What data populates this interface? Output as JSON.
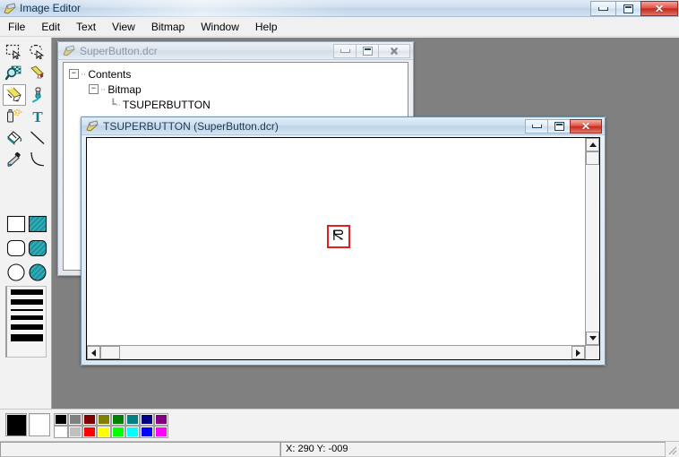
{
  "app": {
    "title": "Image Editor",
    "icon": "image-editor-icon",
    "window_controls": [
      {
        "name": "minimize",
        "glyph": "minimize-icon"
      },
      {
        "name": "maximize",
        "glyph": "maximize-icon"
      },
      {
        "name": "close",
        "glyph": "✕"
      }
    ]
  },
  "menu": {
    "items": [
      {
        "label": "File"
      },
      {
        "label": "Edit"
      },
      {
        "label": "Text"
      },
      {
        "label": "View"
      },
      {
        "label": "Bitmap"
      },
      {
        "label": "Window"
      },
      {
        "label": "Help"
      }
    ]
  },
  "toolbox": {
    "tools": [
      {
        "name": "rectangular-select-tool",
        "icon": "rectangular-select-icon",
        "selected": false
      },
      {
        "name": "lasso-select-tool",
        "icon": "lasso-select-icon",
        "selected": false
      },
      {
        "name": "zoom-tool",
        "icon": "magnifier-icon",
        "selected": false
      },
      {
        "name": "eraser-tool",
        "icon": "eraser-icon",
        "selected": false
      },
      {
        "name": "pencil-tool",
        "icon": "pencil-icon",
        "selected": true
      },
      {
        "name": "paintbrush-tool",
        "icon": "paintbrush-icon",
        "selected": false
      },
      {
        "name": "airbrush-tool",
        "icon": "airbrush-icon",
        "selected": false
      },
      {
        "name": "text-tool",
        "icon": "text-T-icon",
        "selected": false
      },
      {
        "name": "fill-tool",
        "icon": "paint-bucket-icon",
        "selected": false
      },
      {
        "name": "line-tool",
        "icon": "line-icon",
        "selected": false
      },
      {
        "name": "eyedropper-tool",
        "icon": "eyedropper-icon",
        "selected": false
      },
      {
        "name": "curve-tool",
        "icon": "curve-icon",
        "selected": false
      }
    ],
    "shapes": [
      {
        "name": "rectangle-outline-tool",
        "icon": "rectangle-outline-icon",
        "filled": false,
        "shape": "rect"
      },
      {
        "name": "rectangle-filled-tool",
        "icon": "rectangle-filled-icon",
        "filled": true,
        "shape": "rect"
      },
      {
        "name": "rounded-rect-outline-tool",
        "icon": "rounded-rect-outline-icon",
        "filled": false,
        "shape": "round"
      },
      {
        "name": "rounded-rect-filled-tool",
        "icon": "rounded-rect-filled-icon",
        "filled": true,
        "shape": "round"
      },
      {
        "name": "ellipse-outline-tool",
        "icon": "ellipse-outline-icon",
        "filled": false,
        "shape": "circle"
      },
      {
        "name": "ellipse-filled-tool",
        "icon": "ellipse-filled-icon",
        "filled": true,
        "shape": "circle"
      }
    ],
    "fill_color": "#2d9aa3",
    "line_widths": [
      6,
      6,
      2,
      5,
      6,
      8
    ]
  },
  "palette": {
    "foreground_color": "#000000",
    "background_color": "#ffffff",
    "swatches_row1": [
      "#000000",
      "#808080",
      "#800000",
      "#808000",
      "#008000",
      "#008080",
      "#000080",
      "#800080"
    ],
    "swatches_row2": [
      "#ffffff",
      "#c0c0c0",
      "#ff0000",
      "#ffff00",
      "#00ff00",
      "#00ffff",
      "#0000ff",
      "#ff00ff"
    ]
  },
  "statusbar": {
    "left_pane": "",
    "coords": "X: 290  Y: -009"
  },
  "windows": {
    "resource_window": {
      "title": "SuperButton.dcr",
      "icon": "resource-file-icon",
      "active": false,
      "controls": [
        {
          "name": "minimize",
          "glyph": "minimize-icon"
        },
        {
          "name": "restore",
          "glyph": "restore-icon"
        },
        {
          "name": "close",
          "glyph": "✕"
        }
      ],
      "tree": [
        {
          "label": "Contents",
          "depth": 0,
          "expander": "−",
          "has_expander": true
        },
        {
          "label": "Bitmap",
          "depth": 1,
          "expander": "−",
          "has_expander": true
        },
        {
          "label": "TSUPERBUTTON",
          "depth": 2,
          "expander": "",
          "has_expander": false
        }
      ]
    },
    "bitmap_window": {
      "title": "TSUPERBUTTON (SuperButton.dcr)",
      "icon": "bitmap-editor-icon",
      "active": true,
      "controls": [
        {
          "name": "minimize",
          "glyph": "minimize-icon"
        },
        {
          "name": "restore",
          "glyph": "restore-icon"
        },
        {
          "name": "close",
          "glyph": "✕"
        }
      ],
      "selection_border_color": "#e02020",
      "bitmap_label": "cursor-arrow-bitmap"
    }
  }
}
